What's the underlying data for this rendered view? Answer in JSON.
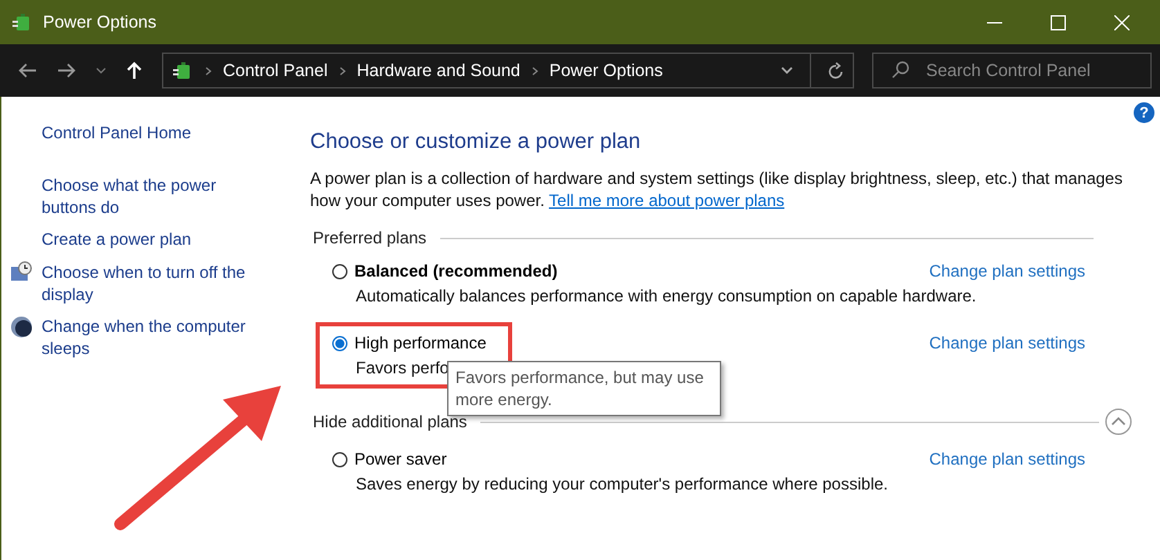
{
  "window": {
    "title": "Power Options"
  },
  "address_bar": {
    "crumbs": [
      "Control Panel",
      "Hardware and Sound",
      "Power Options"
    ]
  },
  "search": {
    "placeholder": "Search Control Panel"
  },
  "help": {
    "glyph": "?"
  },
  "sidebar": {
    "items": [
      {
        "label": "Control Panel Home"
      },
      {
        "label": "Choose what the power buttons do"
      },
      {
        "label": "Create a power plan"
      },
      {
        "label": "Choose when to turn off the display"
      },
      {
        "label": "Change when the computer sleeps"
      }
    ]
  },
  "main": {
    "heading": "Choose or customize a power plan",
    "intro": "A power plan is a collection of hardware and system settings (like display brightness, sleep, etc.) that manages how your computer uses power.",
    "intro_link": "Tell me more about power plans",
    "preferred_label": "Preferred plans",
    "preferred": [
      {
        "name": "Balanced (recommended)",
        "bold": true,
        "selected": false,
        "description": "Automatically balances performance with energy consumption on capable hardware.",
        "link": "Change plan settings"
      },
      {
        "name": "High performance",
        "bold": false,
        "selected": true,
        "description": "Favors perfo",
        "link": "Change plan settings"
      }
    ],
    "additional_label": "Hide additional plans",
    "additional": [
      {
        "name": "Power saver",
        "bold": false,
        "selected": false,
        "description": "Saves energy by reducing your computer's performance where possible.",
        "link": "Change plan settings"
      }
    ]
  },
  "tooltip": {
    "text": "Favors performance, but may use more energy."
  }
}
